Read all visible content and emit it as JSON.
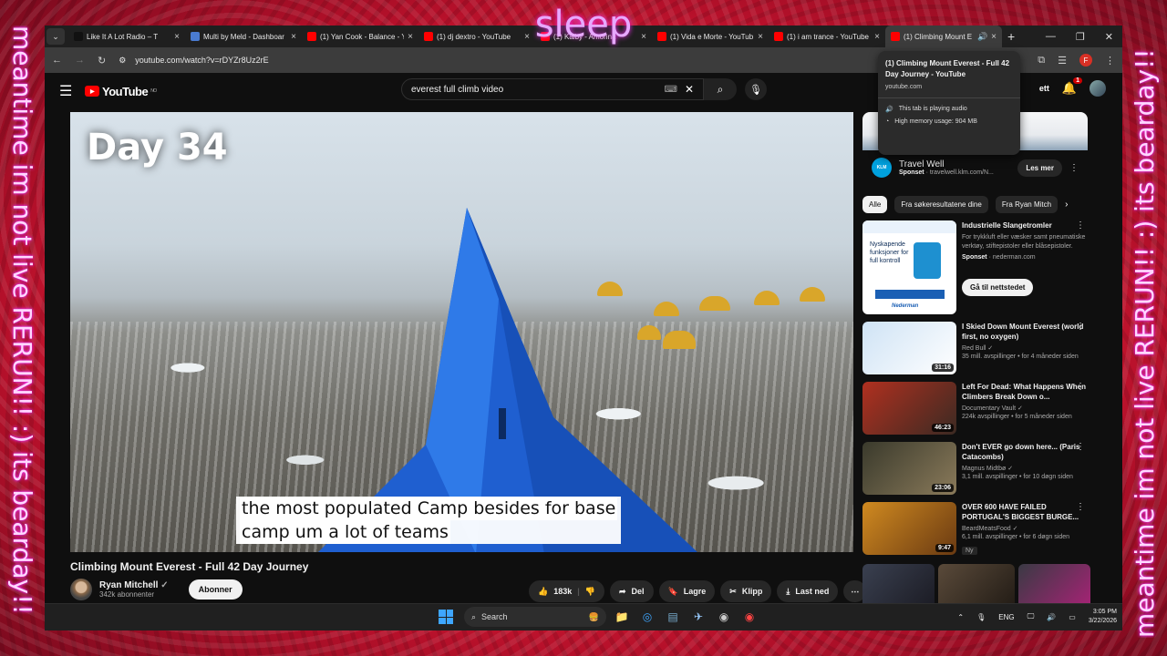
{
  "overlay": {
    "top_text": "sleep",
    "left_text": "meantime im not live RERUN!! :) its bearday!!",
    "right_text": "meantime im not live RERUN!! :) its bearday!!"
  },
  "tabs": [
    {
      "label": "Like It A Lot Radio – T",
      "favicon_color": "#111111"
    },
    {
      "label": "Multi by Meld - Dashboar",
      "favicon_color": "#4a7bd0"
    },
    {
      "label": "(1) Yan Cook - Balance - Y",
      "favicon_color": "#ff0000"
    },
    {
      "label": "(1) dj dextro - YouTube",
      "favicon_color": "#ff0000"
    },
    {
      "label": "(1) Kaiby - Amorina",
      "favicon_color": "#ff0000"
    },
    {
      "label": "(1) Vida e Morte - YouTub",
      "favicon_color": "#ff0000"
    },
    {
      "label": "(1) i am trance - YouTube",
      "favicon_color": "#ff0000"
    },
    {
      "label": "(1) Climbing Mount E",
      "favicon_color": "#ff0000",
      "active": true
    }
  ],
  "address": {
    "url": "youtube.com/watch?v=rDYZr8Uz2rE",
    "profile_initial": "F"
  },
  "tooltip": {
    "title": "(1) Climbing Mount Everest - Full 42 Day Journey - YouTube",
    "domain": "youtube.com",
    "audio": "This tab is playing audio",
    "memory": "High memory usage: 904 MB"
  },
  "youtube": {
    "logo": "YouTube",
    "region": "NO",
    "search_value": "everest full climb video",
    "create_label": "ett",
    "notif_count": "1"
  },
  "video": {
    "day_label": "Day 34",
    "caption_line1": "the most populated Camp besides for base",
    "caption_line2": "camp um a lot of teams",
    "title": "Climbing Mount Everest - Full 42 Day Journey",
    "channel": "Ryan Mitchell",
    "subscribers": "342k abonnenter",
    "subscribe": "Abonner",
    "likes": "183k",
    "share": "Del",
    "save": "Lagre",
    "clip": "Klipp",
    "download": "Last ned"
  },
  "sidebar": {
    "ad": {
      "title": "Travel Well",
      "sponsored": "Sponset",
      "url": "travelwell.klm.com/N...",
      "cta": "Les mer",
      "logo_text": "KLM"
    },
    "chips": [
      "Alle",
      "Fra søkeresultatene dine",
      "Fra Ryan Mitch"
    ],
    "ad2": {
      "title": "Industrielle Slangetromler",
      "desc": "For trykkluft eller væsker samt pneumatiske verktøy, stiftepistoler eller blåsepistoler.",
      "sponsored": "Sponset",
      "url": "nederman.com",
      "cta": "Gå til nettstedet",
      "thumb_text": "Nyskapende funksjoner for full kontroll",
      "brand": "Nederman"
    },
    "recs": [
      {
        "title": "I Skied Down Mount Everest (world first, no oxygen)",
        "channel": "Red Bull",
        "meta": "35 mill. avspillinger • for 4 måneder siden",
        "duration": "31:16",
        "c1": "#cfe3f5",
        "c2": "#ffffff"
      },
      {
        "title": "Left For Dead: What Happens When Climbers Break Down o...",
        "channel": "Documentary Vault",
        "meta": "224k avspillinger • for 5 måneder siden",
        "duration": "46:23",
        "c1": "#b03020",
        "c2": "#3b2a22"
      },
      {
        "title": "Don't EVER go down here... (Paris Catacombs)",
        "channel": "Magnus Midtbø",
        "meta": "3,1 mill. avspillinger • for 10 døgn siden",
        "duration": "23:06",
        "c1": "#3a3a2c",
        "c2": "#8a7a5a"
      },
      {
        "title": "OVER 600 HAVE FAILED PORTUGAL'S BIGGEST BURGE...",
        "channel": "BeardMeatsFood",
        "meta": "6,1 mill. avspillinger • for 6 døgn siden",
        "duration": "9:47",
        "c1": "#d08a20",
        "c2": "#6a3a12",
        "badge": "Ny"
      }
    ]
  },
  "taskbar": {
    "search": "Search",
    "lang": "ENG",
    "time": "3:05 PM",
    "date": "3/22/2026"
  }
}
